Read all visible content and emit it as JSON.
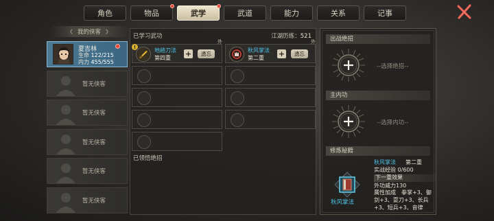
{
  "tabs": [
    {
      "label": "角色",
      "active": false,
      "dot": false
    },
    {
      "label": "物品",
      "active": false,
      "dot": true
    },
    {
      "label": "武学",
      "active": true,
      "dot": true
    },
    {
      "label": "武道",
      "active": false,
      "dot": false
    },
    {
      "label": "能力",
      "active": false,
      "dot": false
    },
    {
      "label": "关系",
      "active": false,
      "dot": false
    },
    {
      "label": "记事",
      "active": false,
      "dot": false
    }
  ],
  "sidebar": {
    "title": "我的侠客",
    "active_hero": {
      "name": "夏吉林",
      "hp_label": "生命",
      "hp_value": "122/215",
      "mp_label": "内力",
      "mp_value": "455/555"
    },
    "empty_label": "暂无侠客"
  },
  "main": {
    "learned_title": "已学习武功",
    "exp_label": "江湖历练：",
    "exp_value": "521",
    "skills": [
      {
        "name": "地趟刀法",
        "level": "第四重",
        "forget": "遗忘",
        "ext": "外",
        "warn": "!"
      },
      {
        "name": "秋风掌法",
        "level": "第二重",
        "forget": "遗忘",
        "ext": "外"
      }
    ],
    "comprehended_title": "已领悟绝招"
  },
  "right": {
    "move_title": "出战绝招",
    "move_hint": "--选择绝招--",
    "inner_title": "主内功",
    "inner_hint": "--选择内功--",
    "manual_title": "修炼秘籍",
    "manual": {
      "name": "秋风掌法",
      "level": "第二重",
      "exp_label": "实战经验",
      "exp_value": "0/600",
      "next_label": "下一重效果",
      "power": "外功威力130",
      "attr_line1": "属性加成　拳掌+3、御",
      "attr_line2": "剑+3、耍刀+3、长兵",
      "attr_line3": "+3、短兵+3、音律"
    }
  },
  "colors": {
    "accent_cyan": "#4ec3e8",
    "active_card": "#3b6580",
    "alert_red": "#e64a3a"
  }
}
